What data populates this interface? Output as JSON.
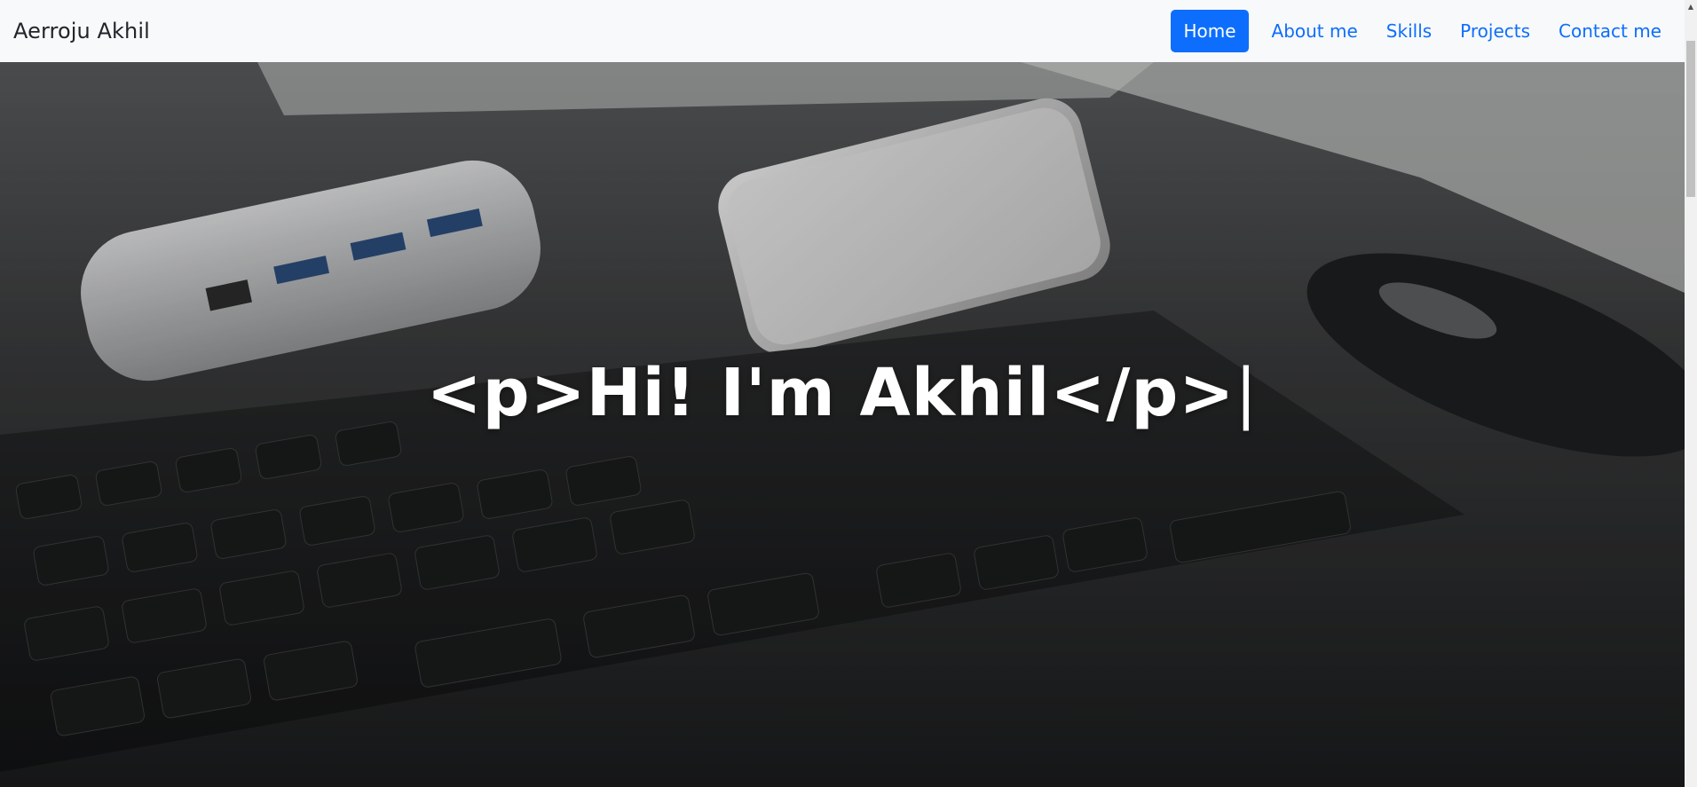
{
  "navbar": {
    "brand": "Aerroju Akhil",
    "links": [
      {
        "label": "Home",
        "active": true
      },
      {
        "label": "About me",
        "active": false
      },
      {
        "label": "Skills",
        "active": false
      },
      {
        "label": "Projects",
        "active": false
      },
      {
        "label": "Contact me",
        "active": false
      }
    ]
  },
  "hero": {
    "title": "<p>Hi! I'm Akhil</p>",
    "cursor": "|",
    "background_description": "keyboard-desk-photo"
  },
  "colors": {
    "navbar_bg": "#f8f9fa",
    "link": "#0d6efd",
    "active_bg": "#0d6efd",
    "active_text": "#ffffff",
    "hero_text": "#ffffff"
  }
}
